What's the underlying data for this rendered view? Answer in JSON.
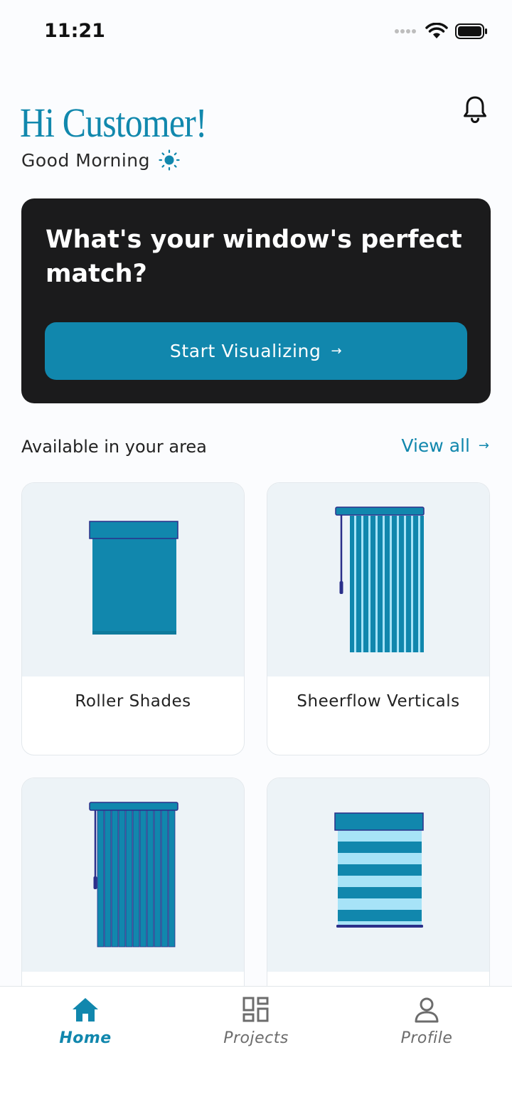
{
  "status_bar": {
    "time": "11:21",
    "icons": [
      "signal-dots-icon",
      "wifi-icon",
      "battery-icon"
    ]
  },
  "greeting": {
    "title": "Hi Customer!",
    "subtitle": "Good Morning",
    "icon": "sun-icon"
  },
  "header": {
    "notification_icon": "bell-icon"
  },
  "hero": {
    "title": "What's your window's perfect match?",
    "button_label": "Start Visualizing",
    "button_arrow": "→"
  },
  "section": {
    "title": "Available in your area",
    "view_all_label": "View all",
    "view_all_arrow": "→"
  },
  "products": [
    {
      "label": "Roller Shades"
    },
    {
      "label": "Sheerflow Verticals"
    },
    {
      "label": ""
    },
    {
      "label": ""
    }
  ],
  "nav": {
    "items": [
      {
        "label": "Home",
        "icon": "home-icon",
        "active": true
      },
      {
        "label": "Projects",
        "icon": "grid-icon",
        "active": false
      },
      {
        "label": "Profile",
        "icon": "user-icon",
        "active": false
      }
    ]
  },
  "colors": {
    "accent": "#1187ad",
    "hero_bg": "#1b1b1c",
    "card_image_bg": "#edf3f7",
    "light_stripe": "#a7e3f7",
    "dark_outline": "#2b2f8a"
  }
}
